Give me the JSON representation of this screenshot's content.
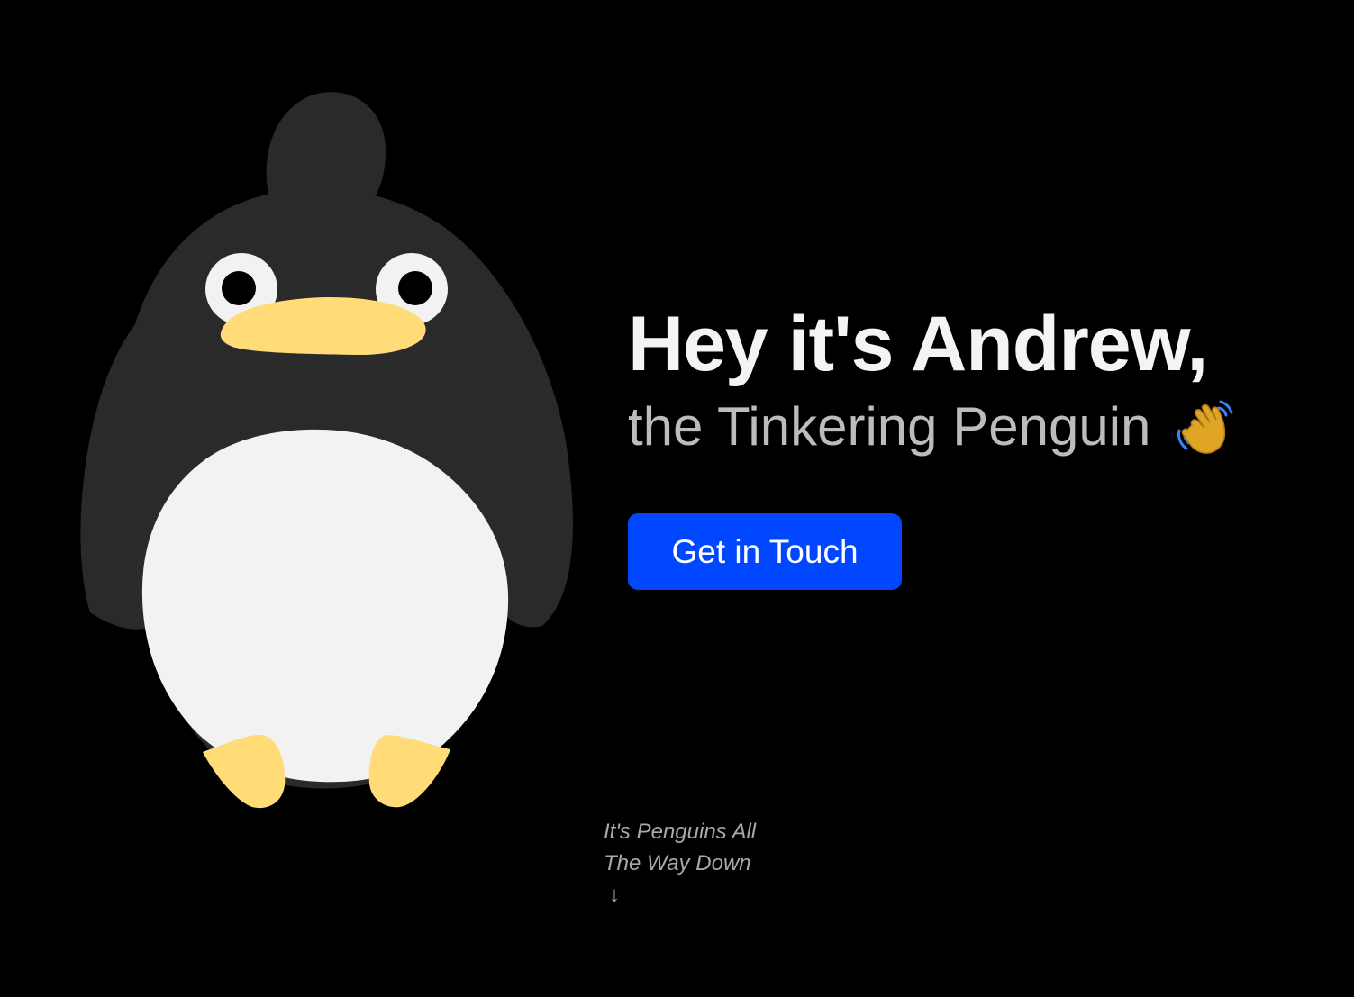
{
  "hero": {
    "headline": "Hey it's Andrew,",
    "subheadline": "the Tinkering Penguin",
    "wave_icon": "waving-hand-icon",
    "cta_label": "Get in Touch"
  },
  "scroll_hint": {
    "line1": "It's Penguins All",
    "line2": "The Way Down",
    "arrow": "↓",
    "arrow_icon": "arrow-down-icon"
  },
  "illustration": {
    "icon": "penguin-illustration",
    "colors": {
      "body": "#2a2a2a",
      "belly": "#f2f2f2",
      "beak_and_feet": "#ffdc78",
      "eyes": "#f2f2f2",
      "pupils": "#000000"
    }
  },
  "theme": {
    "background": "#000000",
    "headline_color": "#f4f4f4",
    "subheadline_color": "#bcbcbc",
    "cta_color": "#0047ff",
    "hint_color": "#a9a9a9"
  }
}
